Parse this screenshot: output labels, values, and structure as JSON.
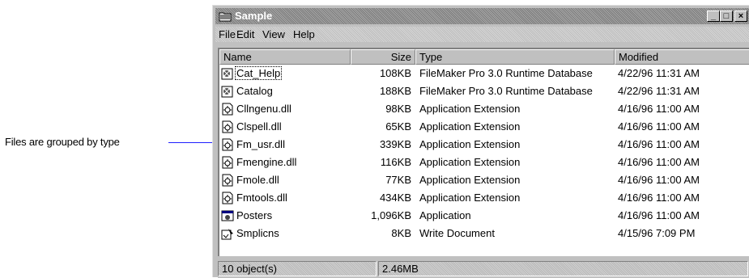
{
  "callout": {
    "text": "Files are grouped by type"
  },
  "window": {
    "title": "Sample",
    "buttons": {
      "minimize": "_",
      "maximize": "□",
      "close": "×"
    }
  },
  "menu": [
    "File",
    "Edit",
    "View",
    "Help"
  ],
  "columns": {
    "name": "Name",
    "size": "Size",
    "type": "Type",
    "modified": "Modified"
  },
  "files": [
    {
      "icon": "filemaker-database-icon",
      "name": "Cat_Help",
      "size": "108KB",
      "type": "FileMaker Pro 3.0 Runtime Database",
      "modified": "4/22/96 11:31 AM"
    },
    {
      "icon": "filemaker-database-icon",
      "name": "Catalog",
      "size": "188KB",
      "type": "FileMaker Pro 3.0 Runtime Database",
      "modified": "4/22/96 11:31 AM"
    },
    {
      "icon": "dll-file-icon",
      "name": "Cllngenu.dll",
      "size": "98KB",
      "type": "Application Extension",
      "modified": "4/16/96 11:00 AM"
    },
    {
      "icon": "dll-file-icon",
      "name": "Clspell.dll",
      "size": "65KB",
      "type": "Application Extension",
      "modified": "4/16/96 11:00 AM"
    },
    {
      "icon": "dll-file-icon",
      "name": "Fm_usr.dll",
      "size": "339KB",
      "type": "Application Extension",
      "modified": "4/16/96 11:00 AM"
    },
    {
      "icon": "dll-file-icon",
      "name": "Fmengine.dll",
      "size": "116KB",
      "type": "Application Extension",
      "modified": "4/16/96 11:00 AM"
    },
    {
      "icon": "dll-file-icon",
      "name": "Fmole.dll",
      "size": "77KB",
      "type": "Application Extension",
      "modified": "4/16/96 11:00 AM"
    },
    {
      "icon": "dll-file-icon",
      "name": "Fmtools.dll",
      "size": "434KB",
      "type": "Application Extension",
      "modified": "4/16/96 11:00 AM"
    },
    {
      "icon": "application-icon",
      "name": "Posters",
      "size": "1,096KB",
      "type": "Application",
      "modified": "4/16/96 11:00 AM"
    },
    {
      "icon": "write-document-icon",
      "name": "Smplicns",
      "size": "8KB",
      "type": "Write Document",
      "modified": "4/15/96 7:09 PM"
    }
  ],
  "status": {
    "count": "10 object(s)",
    "total": "2.46MB"
  }
}
